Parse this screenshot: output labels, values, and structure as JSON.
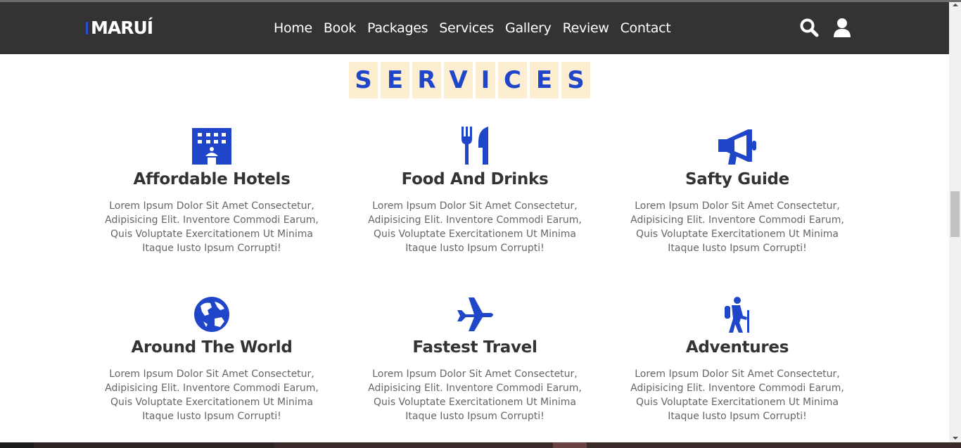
{
  "header": {
    "logo": "MARUÍ",
    "nav": [
      "Home",
      "Book",
      "Packages",
      "Services",
      "Gallery",
      "Review",
      "Contact"
    ]
  },
  "section": {
    "title_letters": [
      "S",
      "E",
      "R",
      "V",
      "I",
      "C",
      "E",
      "S"
    ]
  },
  "services": [
    {
      "title": "Affordable Hotels",
      "icon": "hotel-icon",
      "text": "Lorem Ipsum Dolor Sit Amet Consectetur, Adipisicing Elit. Inventore Commodi Earum, Quis Voluptate Exercitationem Ut Minima Itaque Iusto Ipsum Corrupti!"
    },
    {
      "title": "Food And Drinks",
      "icon": "utensils-icon",
      "text": "Lorem Ipsum Dolor Sit Amet Consectetur, Adipisicing Elit. Inventore Commodi Earum, Quis Voluptate Exercitationem Ut Minima Itaque Iusto Ipsum Corrupti!"
    },
    {
      "title": "Safty Guide",
      "icon": "bullhorn-icon",
      "text": "Lorem Ipsum Dolor Sit Amet Consectetur, Adipisicing Elit. Inventore Commodi Earum, Quis Voluptate Exercitationem Ut Minima Itaque Iusto Ipsum Corrupti!"
    },
    {
      "title": "Around The World",
      "icon": "globe-icon",
      "text": "Lorem Ipsum Dolor Sit Amet Consectetur, Adipisicing Elit. Inventore Commodi Earum, Quis Voluptate Exercitationem Ut Minima Itaque Iusto Ipsum Corrupti!"
    },
    {
      "title": "Fastest Travel",
      "icon": "plane-icon",
      "text": "Lorem Ipsum Dolor Sit Amet Consectetur, Adipisicing Elit. Inventore Commodi Earum, Quis Voluptate Exercitationem Ut Minima Itaque Iusto Ipsum Corrupti!"
    },
    {
      "title": "Adventures",
      "icon": "hiking-icon",
      "text": "Lorem Ipsum Dolor Sit Amet Consectetur, Adipisicing Elit. Inventore Commodi Earum, Quis Voluptate Exercitationem Ut Minima Itaque Iusto Ipsum Corrupti!"
    }
  ],
  "colors": {
    "navbar": "#333333",
    "accent": "#1f46c9",
    "letter_bg": "#fdedd1"
  }
}
